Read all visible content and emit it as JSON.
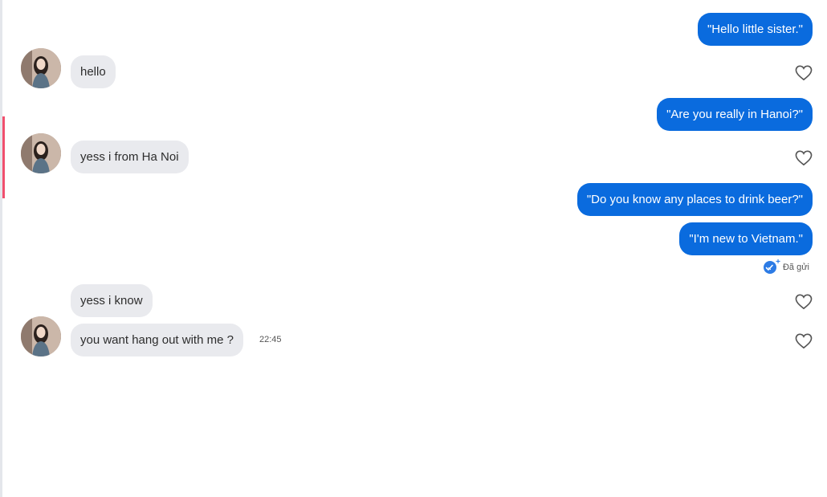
{
  "messages": {
    "m1": {
      "text": "\"Hello little sister.\""
    },
    "m2": {
      "text": "hello"
    },
    "m3": {
      "text": "\"Are you really in Hanoi?\""
    },
    "m4": {
      "text": "yess i from Ha Noi"
    },
    "m5": {
      "text": "\"Do you know any places to drink beer?\""
    },
    "m6": {
      "text": "\"I'm new to Vietnam.\""
    },
    "m7": {
      "text": "yess i know"
    },
    "m8": {
      "text": "you want hang out with me ?"
    }
  },
  "status": {
    "sent_label": "Đã gửi",
    "last_time": "22:45"
  },
  "colors": {
    "outgoing_bubble": "#0a6bde",
    "incoming_bubble": "#e9eaee",
    "accent_marker": "#f0506e"
  },
  "icons": {
    "like": "heart-outline-icon",
    "sent": "double-check-icon"
  }
}
